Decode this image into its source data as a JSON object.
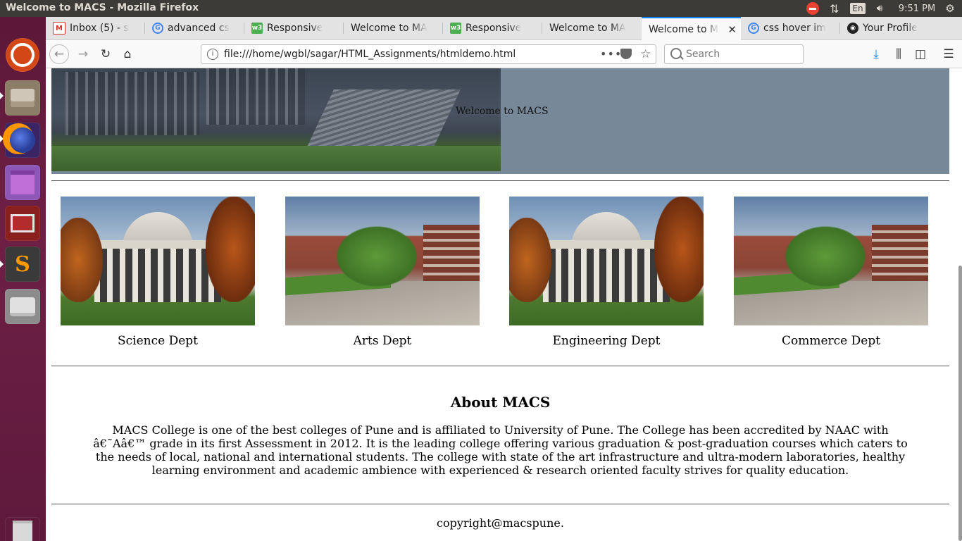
{
  "os": {
    "window_title": "Welcome to MACS - Mozilla Firefox",
    "language": "En",
    "clock": "9:51 PM"
  },
  "browser": {
    "tabs": [
      {
        "label": "Inbox (5) - s",
        "icon": "gmail-icon",
        "active": false
      },
      {
        "label": "advanced cs",
        "icon": "google-icon",
        "active": false
      },
      {
        "label": "Responsive",
        "icon": "w3schools-icon",
        "active": false
      },
      {
        "label": "Welcome to MA",
        "icon": "none",
        "active": false
      },
      {
        "label": "Responsive",
        "icon": "w3schools-icon",
        "active": false
      },
      {
        "label": "Welcome to MA",
        "icon": "none",
        "active": false
      },
      {
        "label": "Welcome to MA",
        "icon": "none",
        "active": true
      },
      {
        "label": "css hover im",
        "icon": "google-icon",
        "active": false
      },
      {
        "label": "Your Profile",
        "icon": "github-icon",
        "active": false
      }
    ],
    "url": "file:///home/wgbl/sagar/HTML_Assignments/htmldemo.html",
    "search_placeholder": "Search",
    "accent_color": "#0a84ff"
  },
  "page": {
    "hero_text": "Welcome to MACS",
    "hero_bg_color": "#778899",
    "departments": [
      {
        "caption": "Science Dept",
        "image": "dome-building"
      },
      {
        "caption": "Arts Dept",
        "image": "campus-courtyard"
      },
      {
        "caption": "Engineering Dept",
        "image": "dome-building"
      },
      {
        "caption": "Commerce Dept",
        "image": "campus-courtyard"
      }
    ],
    "about_title": "About MACS",
    "about_text": "MACS College is one of the best colleges of Pune and is affiliated to University of Pune. The College has been accredited by NAAC with â€˜Aâ€™ grade in its first Assessment in 2012. It is the leading college offering various graduation & post-graduation courses which caters to the needs of local, national and international students. The college with state of the art infrastructure and ultra-modern laboratories, healthy learning environment and academic ambience with experienced & research oriented faculty strives for quality education.",
    "footer": "copyright@macspune."
  }
}
